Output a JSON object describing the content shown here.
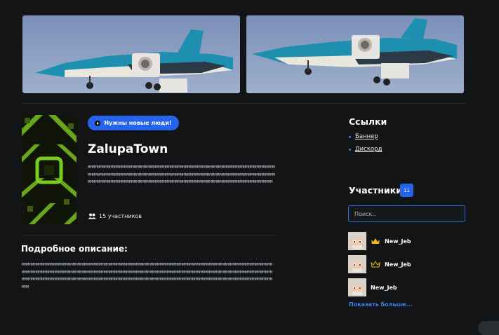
{
  "header": {
    "banners": [
      {
        "name": "banner-jet-left"
      },
      {
        "name": "banner-jet-right"
      }
    ]
  },
  "server": {
    "status_pill": "Нужны новые люди!",
    "title": "ZalupaTown",
    "short_description": "MMMMMMMMMMMMMMMMMMMMMMMMMMMMMMMMMMMMMMMMMMMMMMMMMMMMMMMMMMMMMMMMMMMMMMMMMMMMMMMMMMMMMMMMMMMMMMMMMMMMMMMMMMMMMMMMMMMMMMMMMMMMMMMMMMMMMMMMMMMMMMMMMMMMMMMMMMMMMMMMMMMMMMMMMMMMMMMMMMMMMMMMMMMMMMMMMMMMMMMMMMMMMMMMMMMMMMMMMMMMMMMMMMMMMM",
    "members_count_label": "15 участников",
    "detail_heading": "Подробное описание:",
    "detail_text": "MMMMMMMMMMMMMMMMMMMMMMMMMMMMMMMMMMMMMMMMMMMMMMMMMMMMMMMMMMMMMMMMMMMMMMMMMMMMMMMMMMMMMMMMMMMMMMMMMMMMMMMMMMMMMMMMMMMMMMMMMMMMMMMMMMMMMMMMMMMMMMMMMMMMMMMMMMMMMMMMMMMMMMMMMMMMMMMMMMMMMMMMMMMMMMMMMMMMMMMMMMMMMMMMMMMMMMMMMMMMMMMMMMMMMMMMMMMMMMMMMMMMMMMMMMMMMMMMMMMMMMMMMMMMMMMMMMMMMMMMMMMMMMMMMMMMMMMMMMMMMMMMMMMMMMMM"
  },
  "sidebar": {
    "links_heading": "Ссылки",
    "links": [
      "Баннер",
      "Дискорд"
    ],
    "members_heading": "Участники",
    "members_badge": "11",
    "search_placeholder": "Поиск..",
    "members": [
      {
        "name": "New_Jeb",
        "crown": "gold"
      },
      {
        "name": "New_Jeb",
        "crown": "outline"
      },
      {
        "name": "New_Jeb",
        "crown": "none"
      }
    ],
    "show_more": "Показать больше..."
  },
  "colors": {
    "accent": "#2563eb",
    "link": "#3b82f6",
    "background": "#121416"
  }
}
